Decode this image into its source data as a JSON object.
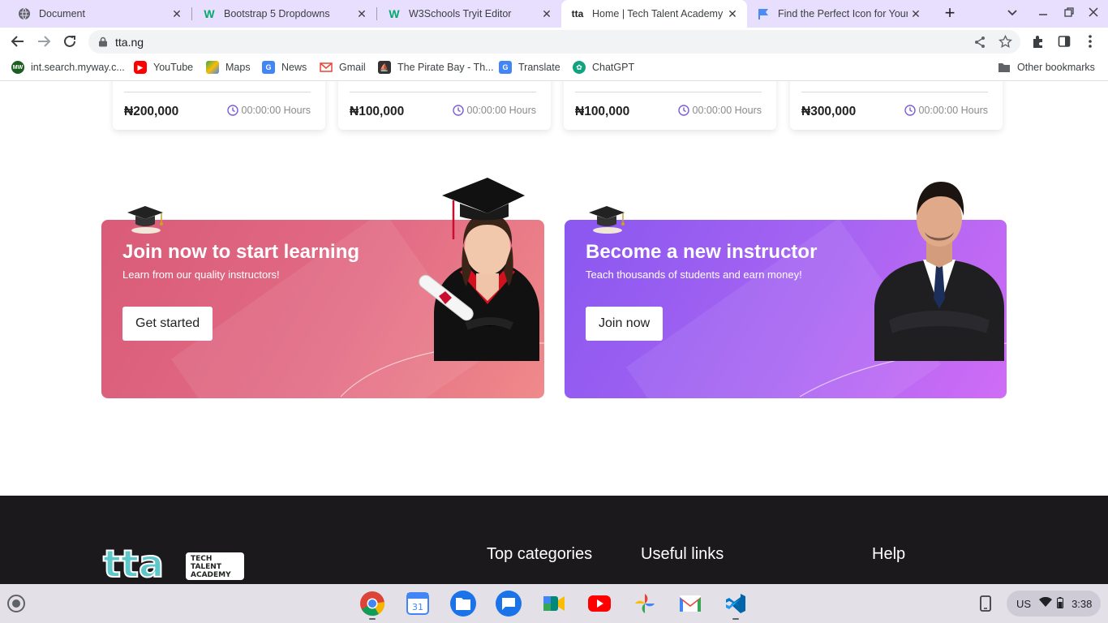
{
  "browser": {
    "tabs": [
      {
        "title": "Document",
        "favicon": "globe-icon"
      },
      {
        "title": "Bootstrap 5 Dropdowns",
        "favicon": "w3schools-icon"
      },
      {
        "title": "W3Schools Tryit Editor",
        "favicon": "w3schools-icon"
      },
      {
        "title": "Home | Tech Talent Academy",
        "favicon": "tta-icon",
        "active": true
      },
      {
        "title": "Find the Perfect Icon for Your Project",
        "favicon": "flag-icon"
      }
    ],
    "url": "tta.ng",
    "bookmarks": [
      {
        "label": "int.search.myway.c...",
        "icon": "myway-icon",
        "color": "#1b5e20"
      },
      {
        "label": "YouTube",
        "icon": "youtube-icon",
        "color": "#ff0000"
      },
      {
        "label": "Maps",
        "icon": "maps-icon",
        "color": "#34a853"
      },
      {
        "label": "News",
        "icon": "news-icon",
        "color": "#4285f4"
      },
      {
        "label": "Gmail",
        "icon": "gmail-icon",
        "color": "#ea4335"
      },
      {
        "label": "The Pirate Bay - Th...",
        "icon": "pirate-icon",
        "color": "#333333"
      },
      {
        "label": "Translate",
        "icon": "translate-icon",
        "color": "#4285f4"
      },
      {
        "label": "ChatGPT",
        "icon": "chatgpt-icon",
        "color": "#10a37f"
      }
    ],
    "other_bookmarks": "Other bookmarks"
  },
  "courses": [
    {
      "price": "₦200,000",
      "hours": "00:00:00 Hours"
    },
    {
      "price": "₦100,000",
      "hours": "00:00:00 Hours"
    },
    {
      "price": "₦100,000",
      "hours": "00:00:00 Hours"
    },
    {
      "price": "₦300,000",
      "hours": "00:00:00 Hours"
    }
  ],
  "banners": {
    "learn": {
      "title": "Join now to start learning",
      "subtitle": "Learn from our quality instructors!",
      "button": "Get started"
    },
    "teach": {
      "title": "Become a new instructor",
      "subtitle": "Teach thousands of students and earn money!",
      "button": "Join now"
    }
  },
  "footer": {
    "logo_text": "tta",
    "logo_subtitle": "TECH TALENT ACADEMY",
    "headings": [
      "Top categories",
      "Useful links",
      "Help"
    ]
  },
  "shelf": {
    "apps": [
      "chrome-icon",
      "calendar-icon",
      "files-icon",
      "messages-icon",
      "meet-icon",
      "youtube-icon",
      "photos-icon",
      "gmail-icon",
      "vscode-icon"
    ],
    "locale": "US",
    "time": "3:38"
  },
  "colors": {
    "learn_banner": "#e26b85",
    "teach_banner": "#a865f2",
    "footer_bg": "#1b191c",
    "accent_purple": "#7b5cd6"
  }
}
